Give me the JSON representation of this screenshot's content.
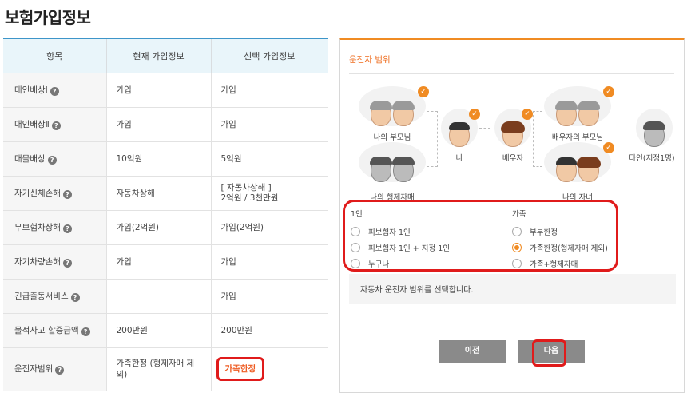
{
  "page": {
    "title": "보험가입정보"
  },
  "table": {
    "headers": [
      "항목",
      "현재 가입정보",
      "선택 가입정보"
    ],
    "rows": [
      {
        "label": "대인배상Ⅰ",
        "current": "가입",
        "selected": "가입"
      },
      {
        "label": "대인배상Ⅱ",
        "current": "가입",
        "selected": "가입"
      },
      {
        "label": "대물배상",
        "current": "10억원",
        "selected": "5억원"
      },
      {
        "label": "자기신체손해",
        "current": "자동차상해",
        "selected_line1": "[ 자동차상해 ]",
        "selected_line2": "2억원 / 3천만원"
      },
      {
        "label": "무보험차상해",
        "current": "가입(2억원)",
        "selected": "가입(2억원)"
      },
      {
        "label": "자기차량손해",
        "current": "가입",
        "selected": "가입"
      },
      {
        "label": "긴급출동서비스",
        "current": "",
        "selected": "가입"
      },
      {
        "label": "물적사고 할증금액",
        "current": "200만원",
        "selected": "200만원"
      },
      {
        "label": "운전자범위",
        "current": "가족한정 (형제자매 제외)",
        "selected": "가족한정"
      }
    ],
    "help_glyph": "?"
  },
  "panel": {
    "title": "운전자 범위",
    "figures": {
      "my_parents": "나의 부모님",
      "siblings": "나의 형제자매",
      "me": "나",
      "spouse": "배우자",
      "spouse_parents": "배우자의 부모님",
      "children": "나의 자녀",
      "other": "타인(지정1명)"
    },
    "check_glyph": "✓",
    "single": {
      "heading": "1인",
      "options": [
        "피보험자 1인",
        "피보험자 1인 + 지정 1인",
        "누구나"
      ]
    },
    "family": {
      "heading": "가족",
      "options": [
        "부부한정",
        "가족한정(형제자매 제외)",
        "가족+형제자매"
      ],
      "selected_index": 1
    },
    "notice": "자동차 운전자 범위를 선택합니다.",
    "buttons": {
      "prev": "이전",
      "next": "다음"
    }
  },
  "colors": {
    "accent": "#f08b23",
    "highlight": "#e01b1b",
    "header_rule": "#3d95c9"
  }
}
